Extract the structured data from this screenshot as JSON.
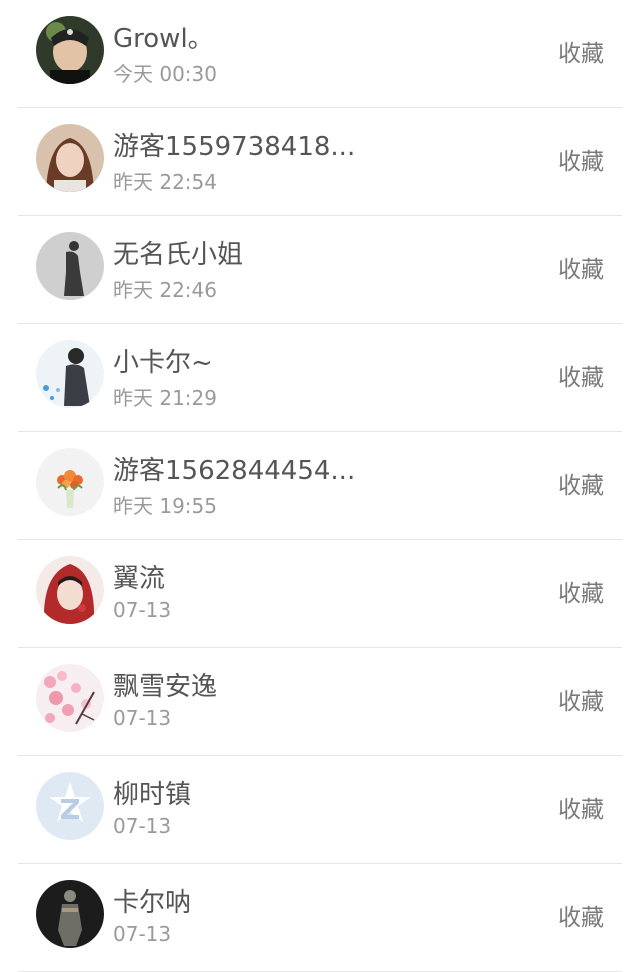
{
  "visitors": [
    {
      "name": "Growl。",
      "time": "今天 00:30",
      "action": "收藏",
      "avatar": "photo-young-man"
    },
    {
      "name": "游客1559738418...",
      "time": "昨天 22:54",
      "action": "收藏",
      "avatar": "photo-young-woman"
    },
    {
      "name": "无名氏小姐",
      "time": "昨天 22:46",
      "action": "收藏",
      "avatar": "grey-silhouette"
    },
    {
      "name": "小卡尔~",
      "time": "昨天 21:29",
      "action": "收藏",
      "avatar": "anime-boy"
    },
    {
      "name": "游客1562844454...",
      "time": "昨天 19:55",
      "action": "收藏",
      "avatar": "flower-vase"
    },
    {
      "name": "翼流",
      "time": "07-13",
      "action": "收藏",
      "avatar": "red-hood-girl"
    },
    {
      "name": "飘雪安逸",
      "time": "07-13",
      "action": "收藏",
      "avatar": "cherry-blossom"
    },
    {
      "name": "柳时镇",
      "time": "07-13",
      "action": "收藏",
      "avatar": "qq-default-z"
    },
    {
      "name": "卡尔呐",
      "time": "07-13",
      "action": "收藏",
      "avatar": "dark-figure"
    }
  ],
  "colors": {
    "name_text": "#555555",
    "time_text": "#9a9a9a",
    "action_text": "#7a7a7a",
    "divider": "#e6e6e6"
  }
}
